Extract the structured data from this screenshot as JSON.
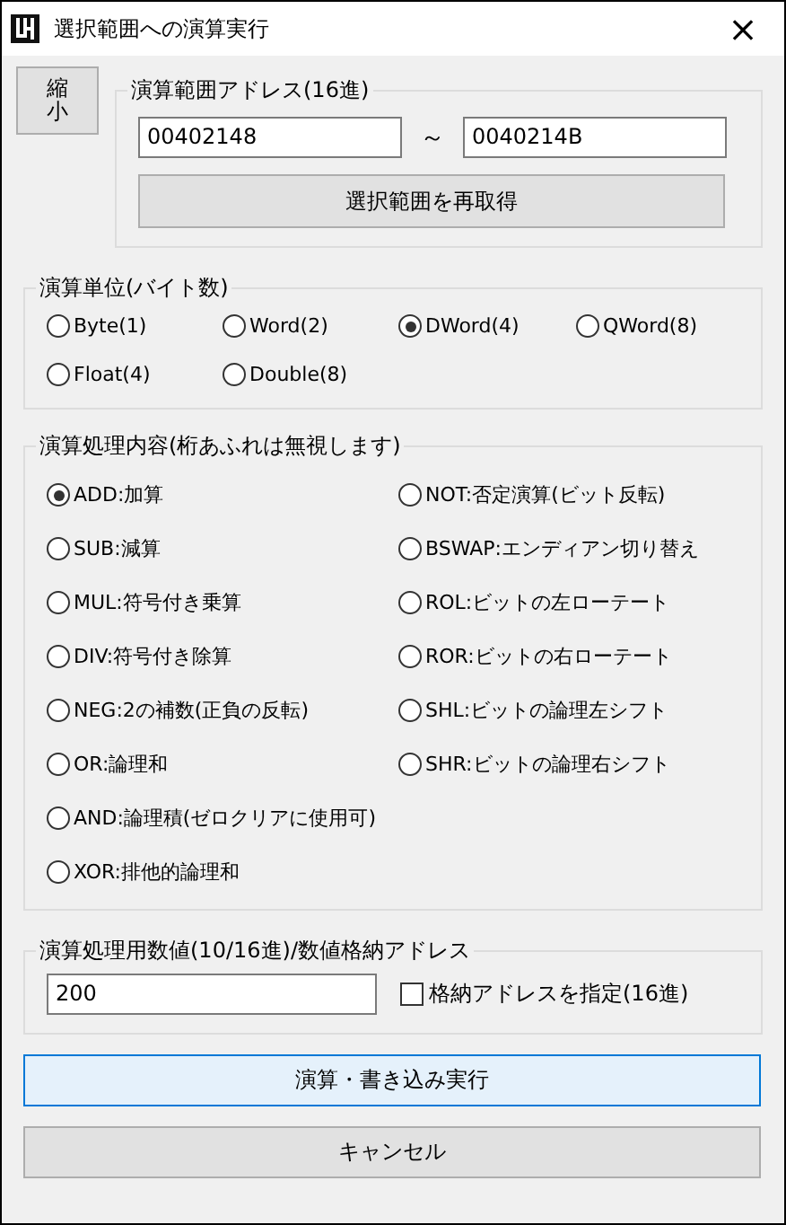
{
  "window": {
    "title": "選択範囲への演算実行",
    "close": "×"
  },
  "shrink_button": "縮小",
  "range_group": {
    "legend": "演算範囲アドレス(16進)",
    "start": "00402148",
    "separator": "～",
    "end": "0040214B",
    "button": "選択範囲を再取得"
  },
  "unit_group": {
    "legend": "演算単位(バイト数)",
    "options": [
      {
        "label": "Byte(1)",
        "selected": false
      },
      {
        "label": "Word(2)",
        "selected": false
      },
      {
        "label": "DWord(4)",
        "selected": true
      },
      {
        "label": "QWord(8)",
        "selected": false
      },
      {
        "label": "Float(4)",
        "selected": false
      },
      {
        "label": "Double(8)",
        "selected": false
      }
    ]
  },
  "operation_group": {
    "legend": "演算処理内容(桁あふれは無視します)",
    "options": [
      {
        "label": "ADD:加算",
        "selected": true
      },
      {
        "label": "NOT:否定演算(ビット反転)",
        "selected": false
      },
      {
        "label": "SUB:減算",
        "selected": false
      },
      {
        "label": "BSWAP:エンディアン切り替え",
        "selected": false
      },
      {
        "label": "MUL:符号付き乗算",
        "selected": false
      },
      {
        "label": "ROL:ビットの左ローテート",
        "selected": false
      },
      {
        "label": "DIV:符号付き除算",
        "selected": false
      },
      {
        "label": "ROR:ビットの右ローテート",
        "selected": false
      },
      {
        "label": "NEG:2の補数(正負の反転)",
        "selected": false
      },
      {
        "label": "SHL:ビットの論理左シフト",
        "selected": false
      },
      {
        "label": "OR:論理和",
        "selected": false
      },
      {
        "label": "SHR:ビットの論理右シフト",
        "selected": false
      },
      {
        "label": "AND:論理積(ゼロクリアに使用可)",
        "selected": false
      },
      {
        "label": "XOR:排他的論理和",
        "selected": false
      }
    ]
  },
  "value_group": {
    "legend": "演算処理用数値(10/16進)/数値格納アドレス",
    "value": "200",
    "checkbox": {
      "label": "格納アドレスを指定(16進)",
      "checked": false
    }
  },
  "buttons": [
    "演算・書き込み実行",
    "キャンセル"
  ]
}
